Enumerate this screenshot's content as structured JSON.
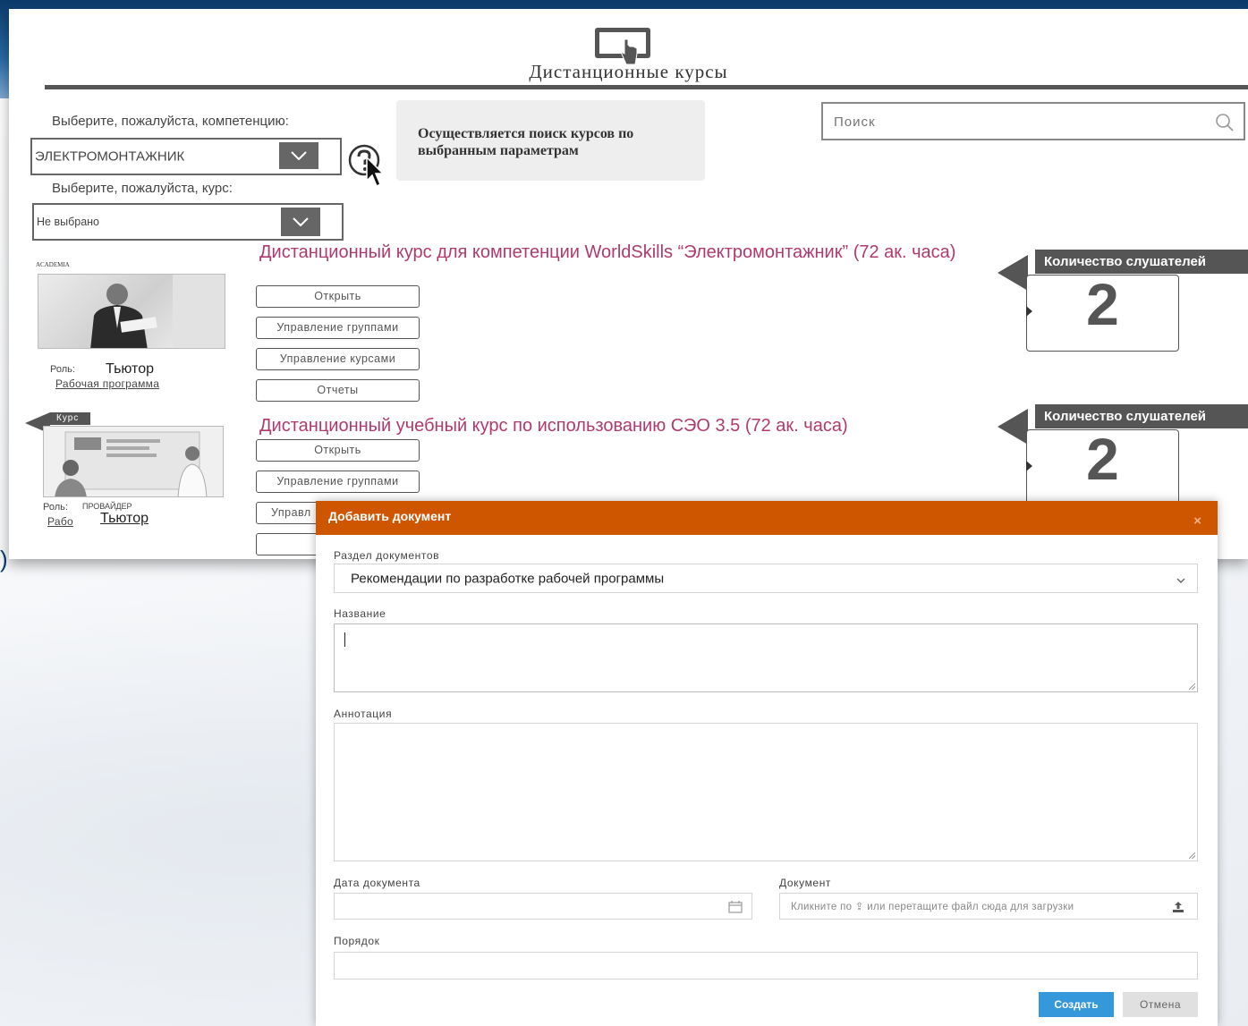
{
  "page": {
    "title": "Дистанционные курсы",
    "competence_label": "Выберите, пожалуйста, компетенцию:",
    "competence_value": "ЭЛЕКТРОМОНТАЖНИК",
    "course_label": "Выберите, пожалуйста, курс:",
    "course_value": "Не выбрано",
    "info_text": "Осуществляется поиск курсов по выбранным параметрам",
    "search_placeholder": "Поиск",
    "counter_label": "Количество слушателей",
    "colors": {
      "accent": "#b03a6e",
      "dark": "#555555",
      "header_bg": "#0b3a6b"
    }
  },
  "courses": [
    {
      "title": "Дистанционный курс для компетенции WorldSkills “Электромонтажник” (72 ак. часа)",
      "logo_text": "ACADEMIA",
      "role_label": "Роль:",
      "role_value": "Тьютор",
      "work_program": "Рабочая программа",
      "buttons": [
        "Открыть",
        "Управление группами",
        "Управление курсами",
        "Отчеты"
      ],
      "listeners": "2"
    },
    {
      "title": "Дистанционный учебный курс по использованию СЭО 3.5  (72 ак. часа)",
      "tag": "Курс",
      "role_label": "Роль:",
      "role_overlay": "ПРОВАЙДЕР",
      "role_value": "Тьютор",
      "work_program": "Рабо",
      "buttons": [
        "Открыть",
        "Управление группами",
        "Управл"
      ],
      "listeners": "2"
    }
  ],
  "modal": {
    "title": "Добавить документ",
    "close": "×",
    "section_label": "Раздел документов",
    "section_value": "Рекомендации по разработке рабочей программы",
    "name_label": "Название",
    "annotation_label": "Аннотация",
    "date_label": "Дата документа",
    "document_label": "Документ",
    "document_placeholder": "Кликните по ⇪ или перетащите файл сюда для загрузки",
    "order_label": "Порядок",
    "create_button": "Создать",
    "cancel_button": "Отмена"
  },
  "icons": {
    "header": "touch-screen-icon",
    "help": "question-icon",
    "search": "search-icon",
    "calendar": "calendar-icon",
    "upload": "upload-icon",
    "dropdown": "chevron-down-icon",
    "cursor": "cursor-icon"
  }
}
